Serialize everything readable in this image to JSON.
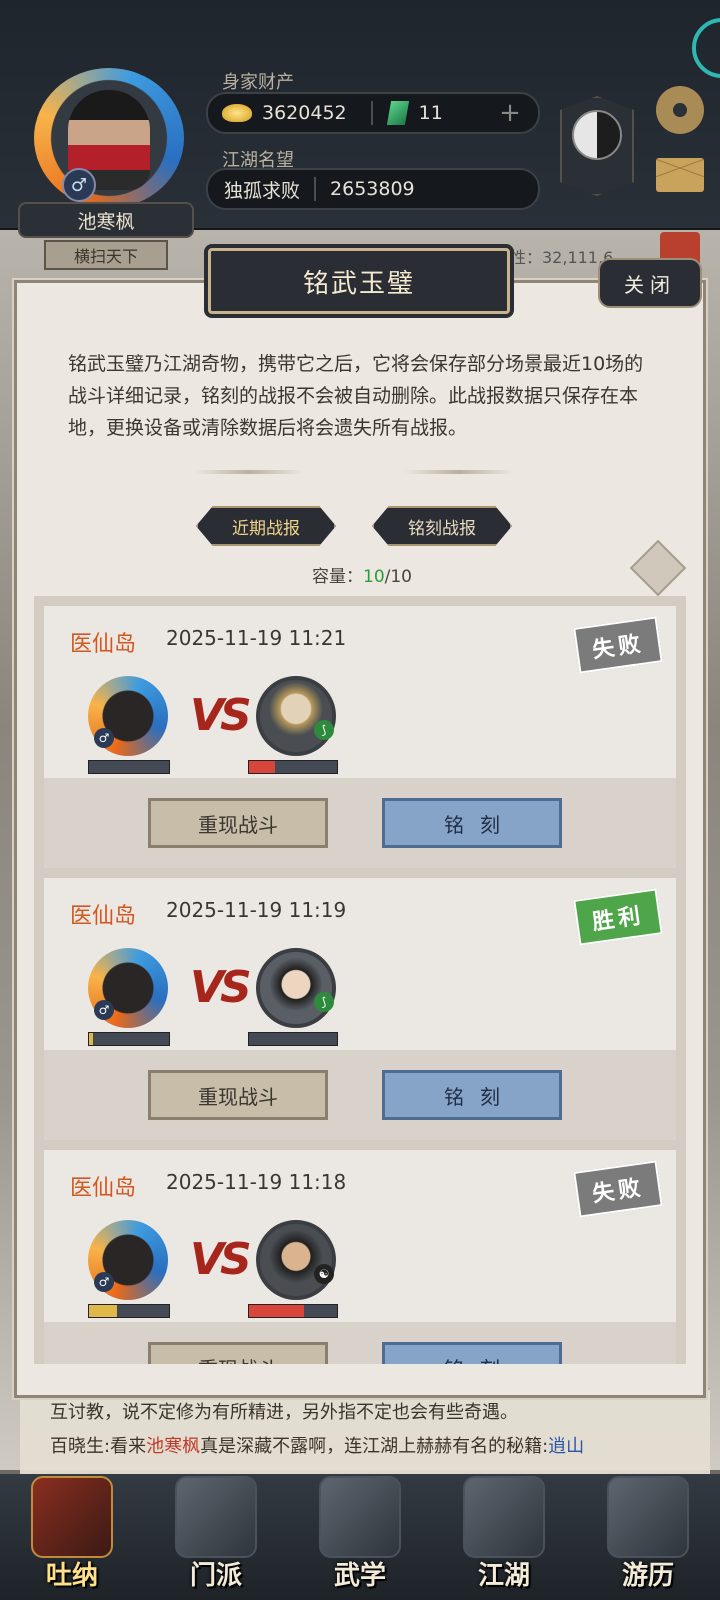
{
  "header": {
    "player_name": "池寒枫",
    "player_title": "横扫天下",
    "gender_symbol": "♂",
    "wealth_label": "身家财产",
    "silver": "3620452",
    "jade": "11",
    "plus": "+",
    "reputation_label": "江湖名望",
    "rep_title": "独孤求败",
    "rep_value": "2653809",
    "attr_text": "性：32,111,6"
  },
  "modal": {
    "title": "铭武玉璧",
    "close_label": "关闭",
    "description": "铭武玉璧乃江湖奇物，携带它之后，它将会保存部分场景最近10场的战斗详细记录，铭刻的战报不会被自动删除。此战报数据只保存在本地，更换设备或清除数据后将会遗失所有战报。",
    "tabs": [
      "近期战报",
      "铭刻战报"
    ],
    "capacity_label": "容量：",
    "capacity_used": "10",
    "capacity_total": "/10"
  },
  "battles": [
    {
      "location": "医仙岛",
      "time": "2025-11-19 11:21",
      "result": "失败",
      "self_hp": 0.0,
      "enemy_hp": 0.3,
      "replay_label": "重现战斗",
      "engrave_label": "铭刻"
    },
    {
      "location": "医仙岛",
      "time": "2025-11-19 11:19",
      "result": "胜利",
      "self_hp": 0.05,
      "enemy_hp": 0.0,
      "replay_label": "重现战斗",
      "engrave_label": "铭刻"
    },
    {
      "location": "医仙岛",
      "time": "2025-11-19 11:18",
      "result": "失败",
      "self_hp": 0.35,
      "enemy_hp": 0.62,
      "replay_label": "重现战斗",
      "engrave_label": "铭刻"
    }
  ],
  "vs_text": "VS",
  "chat": {
    "line1": "互讨教，说不定修为有所精进，另外指不定也会有些奇遇。",
    "line2_prefix": "百晓生:看来",
    "line2_name": "池寒枫",
    "line2_mid": "真是深藏不露啊，连江湖上赫赫有名的秘籍:",
    "line2_link": "逍山"
  },
  "nav": [
    "吐纳",
    "门派",
    "武学",
    "江湖",
    "游历"
  ],
  "colors": {
    "win": "#4fa64a",
    "lose": "#7b7b7b",
    "hp_self": "#e0b84a",
    "hp_enemy": "#d8453a"
  }
}
